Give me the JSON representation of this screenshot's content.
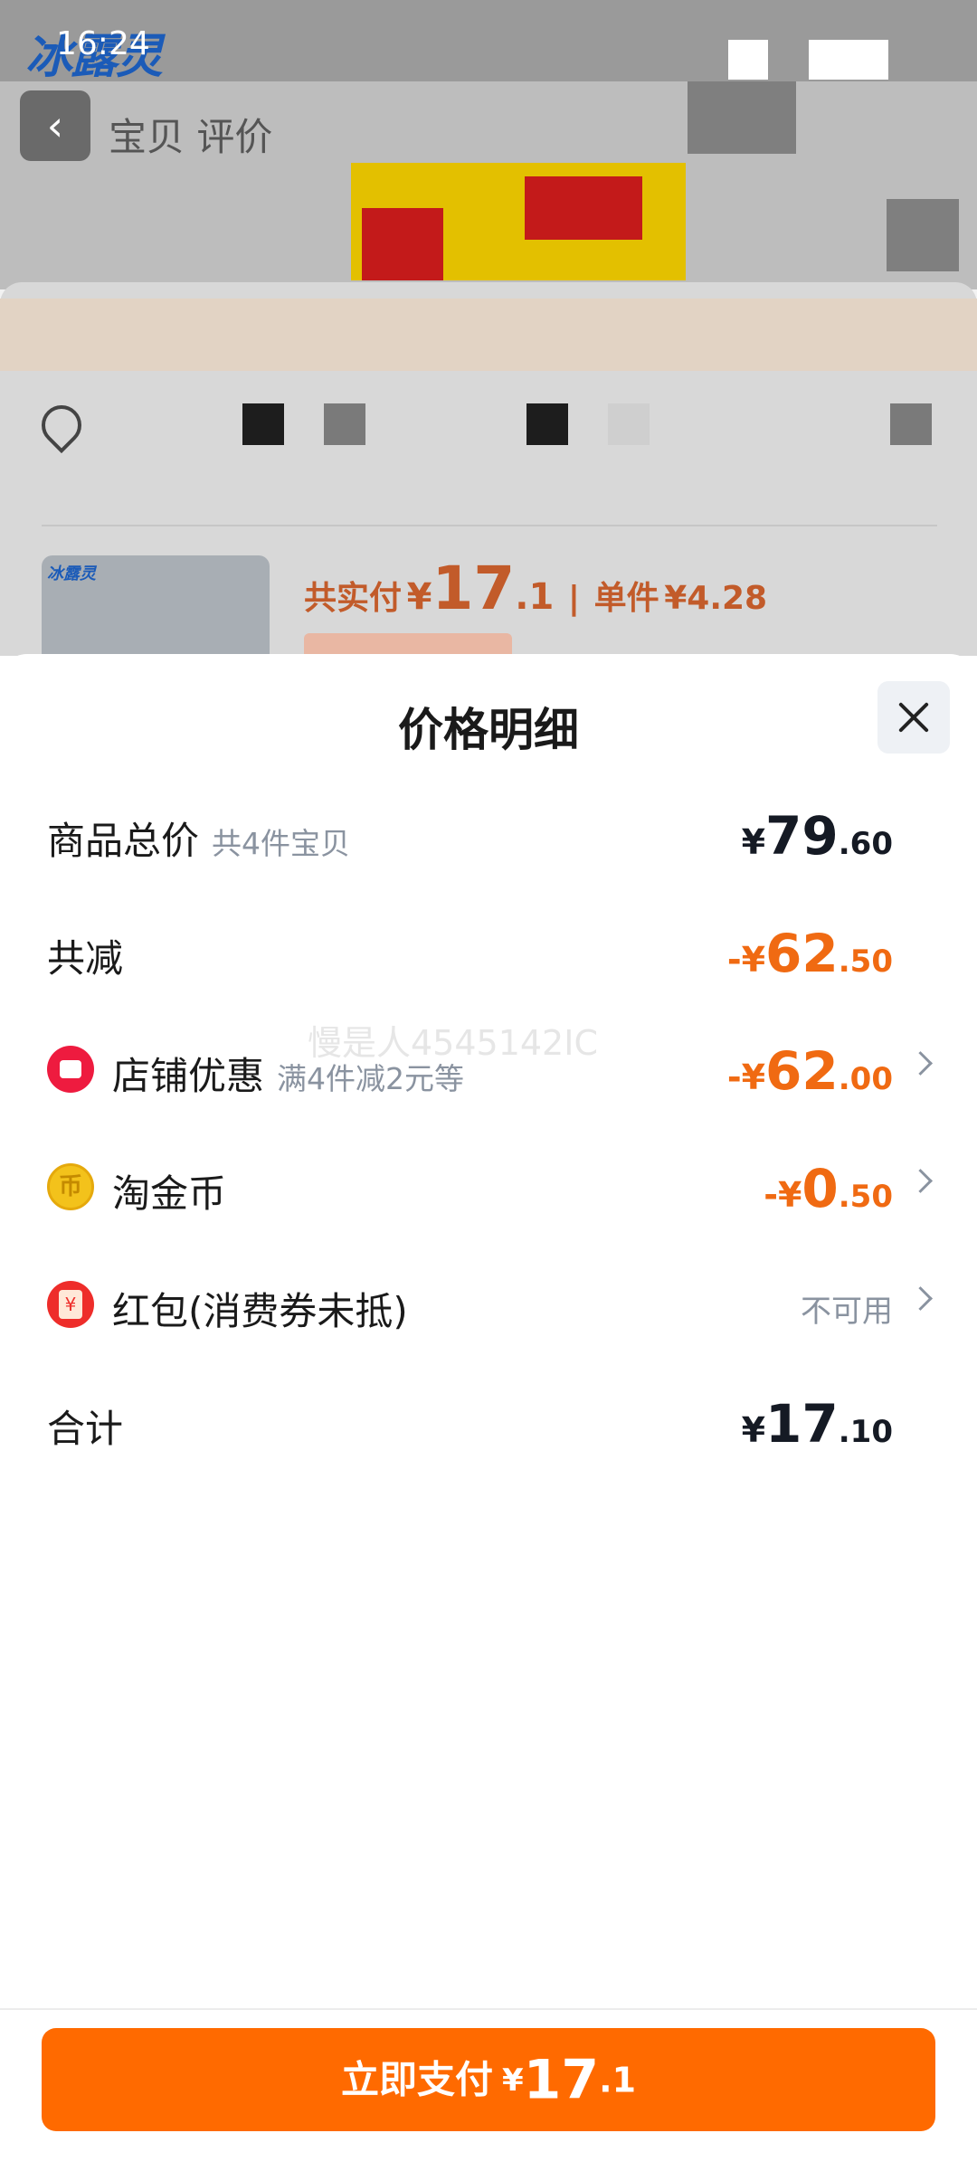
{
  "status_bar": {
    "time": "16:24"
  },
  "background": {
    "brand_logo": "冰露灵",
    "back_icon": "chevron-left-icon",
    "tab_text": "宝贝 评价",
    "product": {
      "price_label": "共实付",
      "price_currency": "¥",
      "price_int": "17",
      "price_dec": ".1",
      "unit_label": "单件",
      "unit_price": "¥4.28"
    }
  },
  "sheet": {
    "title": "价格明细",
    "close_icon": "close-icon",
    "rows": {
      "total": {
        "label": "商品总价",
        "sub": "共4件宝贝",
        "currency": "¥",
        "int": "79",
        "dec": ".60"
      },
      "discount": {
        "label": "共减",
        "currency": "-¥",
        "int": "62",
        "dec": ".50"
      },
      "shop": {
        "label": "店铺优惠",
        "sub": "满4件减2元等",
        "currency": "-¥",
        "int": "62",
        "dec": ".00",
        "icon": "shop-coupon-icon"
      },
      "coins": {
        "label": "淘金币",
        "currency": "-¥",
        "int": "0",
        "dec": ".50",
        "icon": "gold-coin-icon",
        "icon_glyph": "币"
      },
      "red_packet": {
        "label": "红包(消费券未抵)",
        "status": "不可用",
        "icon": "red-packet-icon"
      },
      "sum": {
        "label": "合计",
        "currency": "¥",
        "int": "17",
        "dec": ".10"
      }
    },
    "watermark": "慢是人4545142IC"
  },
  "pay_button": {
    "label": "立即支付",
    "currency": "¥",
    "int": "17",
    "dec": ".1"
  },
  "colors": {
    "accent": "#ff6a00",
    "discount": "#f06a12",
    "text": "#1a1a1a",
    "muted": "#8a93a0"
  }
}
